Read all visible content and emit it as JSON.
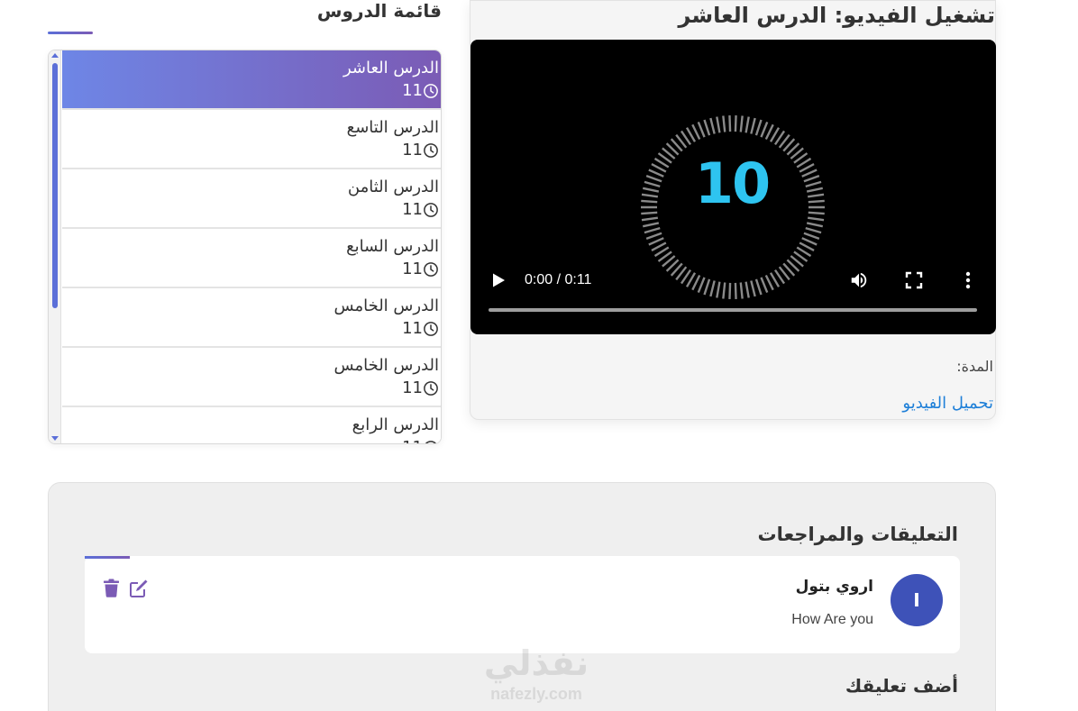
{
  "lessons": {
    "title": "قائمة الدروس",
    "items": [
      {
        "name": "الدرس العاشر",
        "duration": "11",
        "active": true
      },
      {
        "name": "الدرس التاسع",
        "duration": "11",
        "active": false
      },
      {
        "name": "الدرس الثامن",
        "duration": "11",
        "active": false
      },
      {
        "name": "الدرس السابع",
        "duration": "11",
        "active": false
      },
      {
        "name": "الدرس الخامس",
        "duration": "11",
        "active": false
      },
      {
        "name": "الدرس الخامس",
        "duration": "11",
        "active": false
      },
      {
        "name": "الدرس الرابع",
        "duration": "11",
        "active": false
      }
    ]
  },
  "video": {
    "title": "تشغيل الفيديو: الدرس العاشر",
    "countdown_number": "10",
    "time_display": "0:00 / 0:11",
    "progress_fraction": 0,
    "duration_label": "المدة:",
    "download_link": "تحميل الفيديو"
  },
  "comments": {
    "title": "التعليقات والمراجعات",
    "items": [
      {
        "avatar_letter": "I",
        "author": "اروي بتول",
        "text": "How Are you"
      }
    ],
    "add_title": "أضف تعليقك"
  },
  "watermark": {
    "arabic": "نفذلي",
    "latin": "nafezly.com"
  },
  "colors": {
    "accent_start": "#6e86e6",
    "accent_end": "#7b5bb5",
    "link": "#1e7fd8",
    "avatar_bg": "#3e52b8",
    "countdown": "#2ec4f0"
  }
}
